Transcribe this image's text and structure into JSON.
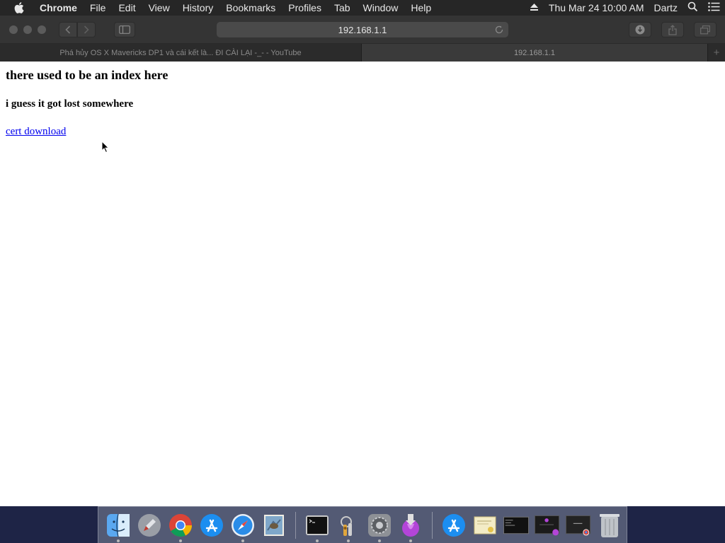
{
  "menubar": {
    "app_name": "Chrome",
    "items": [
      "File",
      "Edit",
      "View",
      "History",
      "Bookmarks",
      "Profiles",
      "Tab",
      "Window",
      "Help"
    ],
    "datetime": "Thu Mar 24  10:00 AM",
    "user": "Dartz"
  },
  "browser": {
    "url": "192.168.1.1",
    "tabs": [
      {
        "title": "Phá hủy OS X Mavericks DP1 và cái kết là... ĐI CÀI LẠI -_- - YouTube",
        "active": false
      },
      {
        "title": "192.168.1.1",
        "active": true
      }
    ]
  },
  "page": {
    "heading": "there used to be an index here",
    "subheading": "i guess it got lost somewhere",
    "link": "cert download"
  },
  "dock": {
    "icons": [
      "finder-icon",
      "launchpad-icon",
      "chrome-icon",
      "app-store-icon",
      "safari-icon",
      "mail-icon",
      "terminal-icon",
      "keychain-icon",
      "system-preferences-icon",
      "installer-icon",
      "app-store-folder-icon",
      "certificate-icon",
      "terminal-window-icon",
      "installer-window-icon",
      "chrome-window-icon",
      "trash-icon"
    ]
  },
  "colors": {
    "menubar": "#262626",
    "toolbar": "#343434",
    "link": "#0000ee",
    "desktop": "#1e2446"
  }
}
